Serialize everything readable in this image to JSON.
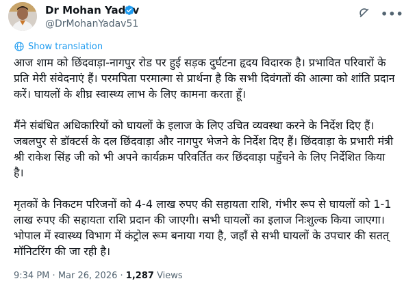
{
  "author": {
    "name": "Dr Mohan Yadav",
    "handle": "@DrMohanYadav51"
  },
  "actions": {
    "show_translation": "Show translation"
  },
  "tweet": {
    "p1": "आज शाम को छिंदवाड़ा-नागपुर रोड पर हुई सड़क दुर्घटना हृदय विदारक है। प्रभावित परिवारों के प्रति मेरी संवेदनाएं हैं। परमपिता परमात्मा से प्रार्थना है कि सभी दिवंगतों की आत्मा को शांति प्रदान करें। घायलों के शीघ्र स्वास्थ्य लाभ के लिए कामना करता हूँ।",
    "p2": "मैंने संबंधित अधिकारियों को घायलों के इलाज के लिए उचित व्यवस्था करने के निर्देश दिए हैं। जबलपुर से डॉक्टर्स के दल छिंदवाड़ा और नागपुर भेजने के निर्देश दिए हैं। छिंदवाड़ा के प्रभारी मंत्री श्री राकेश सिंह जी को भी अपने कार्यक्रम परिवर्तित कर छिंदवाड़ा पहुँचने के लिए निर्देशित किया है।",
    "p3": "मृतकों के निकटम परिजनों को 4-4 लाख रुपए की सहायता राशि, गंभीर रूप से घायलों को 1-1 लाख रुपए की सहायता राशि प्रदान की जाएगी। सभी घायलों का इलाज निःशुल्क किया जाएगा। भोपाल में स्वास्थ्य विभाग में कंट्रोल रूम बनाया गया है, जहाँ से सभी घायलों के उपचार की सतत् मॉनिटरिंग की जा रही है।"
  },
  "meta": {
    "time": "9:34 PM",
    "date": "Mar 26, 2026",
    "views_count": "1,287",
    "views_label": "Views",
    "separator": "·"
  },
  "colors": {
    "accent": "#1d9bf0",
    "secondary_text": "#536471"
  },
  "icons": {
    "verified": "verified-badge-icon",
    "grok": "grok-icon",
    "more": "more-icon",
    "translate": "translate-icon"
  }
}
